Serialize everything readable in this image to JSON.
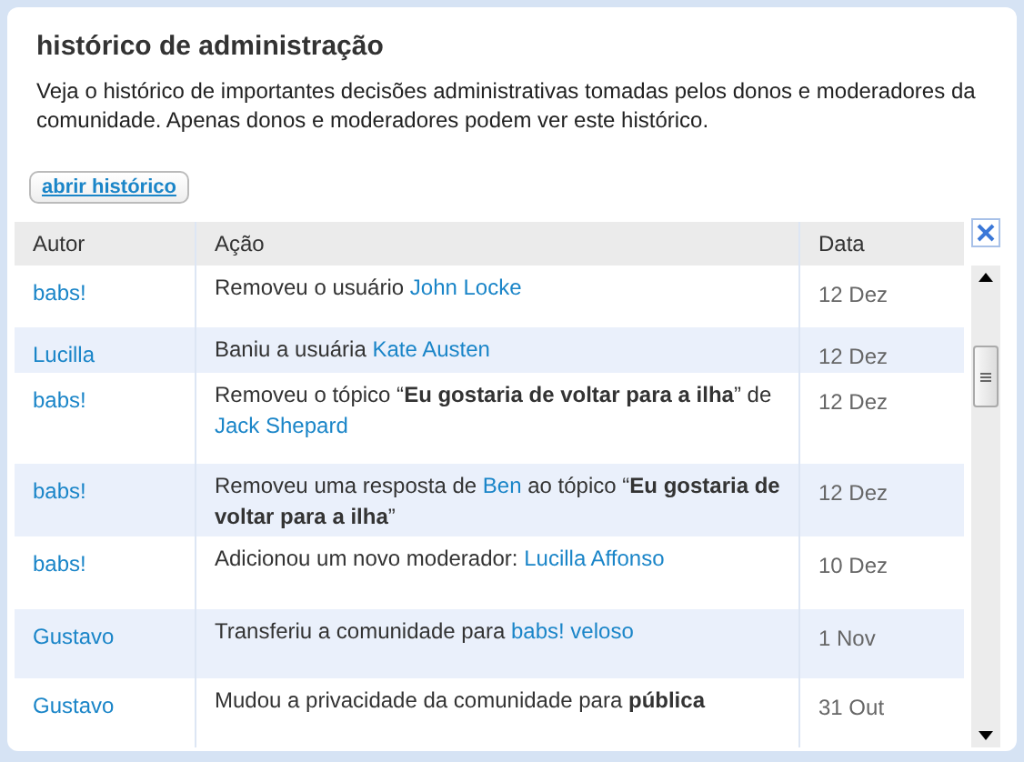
{
  "panel": {
    "title": "histórico de administração",
    "description": "Veja o histórico de importantes decisões administrativas tomadas pelos donos e moderadores da comunidade. Apenas donos e moderadores podem ver este histórico.",
    "open_button": "abrir histórico"
  },
  "table": {
    "columns": [
      "Autor",
      "Ação",
      "Data"
    ],
    "rows": [
      {
        "author": "babs!",
        "action": [
          {
            "kind": "text",
            "text": "Removeu o usuário "
          },
          {
            "kind": "link",
            "text": "John Locke"
          }
        ],
        "date": "12 Dez"
      },
      {
        "author": "Lucilla",
        "action": [
          {
            "kind": "text",
            "text": "Baniu a usuária "
          },
          {
            "kind": "link",
            "text": "Kate Austen"
          }
        ],
        "date": "12 Dez"
      },
      {
        "author": "babs!",
        "action": [
          {
            "kind": "text",
            "text": "Removeu o tópico “**Eu gostaria de voltar para a ilha**” de "
          },
          {
            "kind": "link",
            "text": "Jack Shepard"
          }
        ],
        "date": "12 Dez"
      },
      {
        "author": "babs!",
        "action": [
          {
            "kind": "text",
            "text": "Removeu uma resposta de "
          },
          {
            "kind": "link",
            "text": "Ben"
          },
          {
            "kind": "text",
            "text": " ao tópico “**Eu gostaria de voltar para a ilha**”"
          }
        ],
        "date": "12 Dez"
      },
      {
        "author": "babs!",
        "action": [
          {
            "kind": "text",
            "text": "Adicionou um novo moderador: "
          },
          {
            "kind": "link",
            "text": "Lucilla Affonso"
          }
        ],
        "date": "10 Dez"
      },
      {
        "author": "Gustavo",
        "action": [
          {
            "kind": "text",
            "text": "Transferiu a comunidade para "
          },
          {
            "kind": "link",
            "text": "babs! veloso"
          }
        ],
        "date": "1 Nov"
      },
      {
        "author": "Gustavo",
        "action": [
          {
            "kind": "text",
            "text": "Mudou a privacidade da comunidade para **pública**"
          }
        ],
        "date": "31 Out"
      }
    ]
  }
}
